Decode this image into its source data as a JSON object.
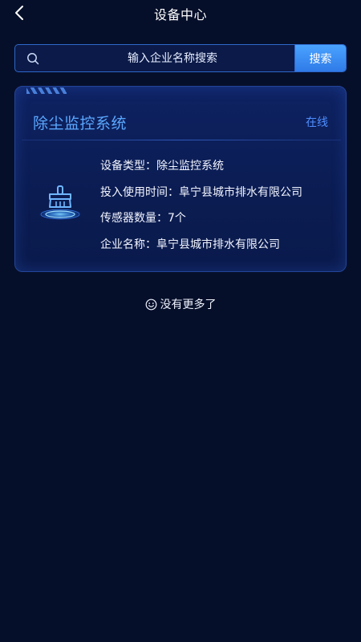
{
  "header": {
    "title": "设备中心"
  },
  "search": {
    "placeholder": "输入企业名称搜索",
    "button_label": "搜索"
  },
  "device_card": {
    "title": "除尘监控系统",
    "status": "在线",
    "fields": [
      {
        "label": "设备类型：",
        "value": "除尘监控系统"
      },
      {
        "label": "投入使用时间：",
        "value": "阜宁县城市排水有限公司"
      },
      {
        "label": "传感器数量：",
        "value": "7个"
      },
      {
        "label": "企业名称：",
        "value": "阜宁县城市排水有限公司"
      }
    ],
    "icon": "broom-icon"
  },
  "list_footer": {
    "text": "没有更多了",
    "icon": "smile-icon"
  },
  "colors": {
    "background": "#060f2a",
    "accent": "#5aa8ff",
    "button": "#3a8bf0",
    "card_border": "#23459a"
  }
}
